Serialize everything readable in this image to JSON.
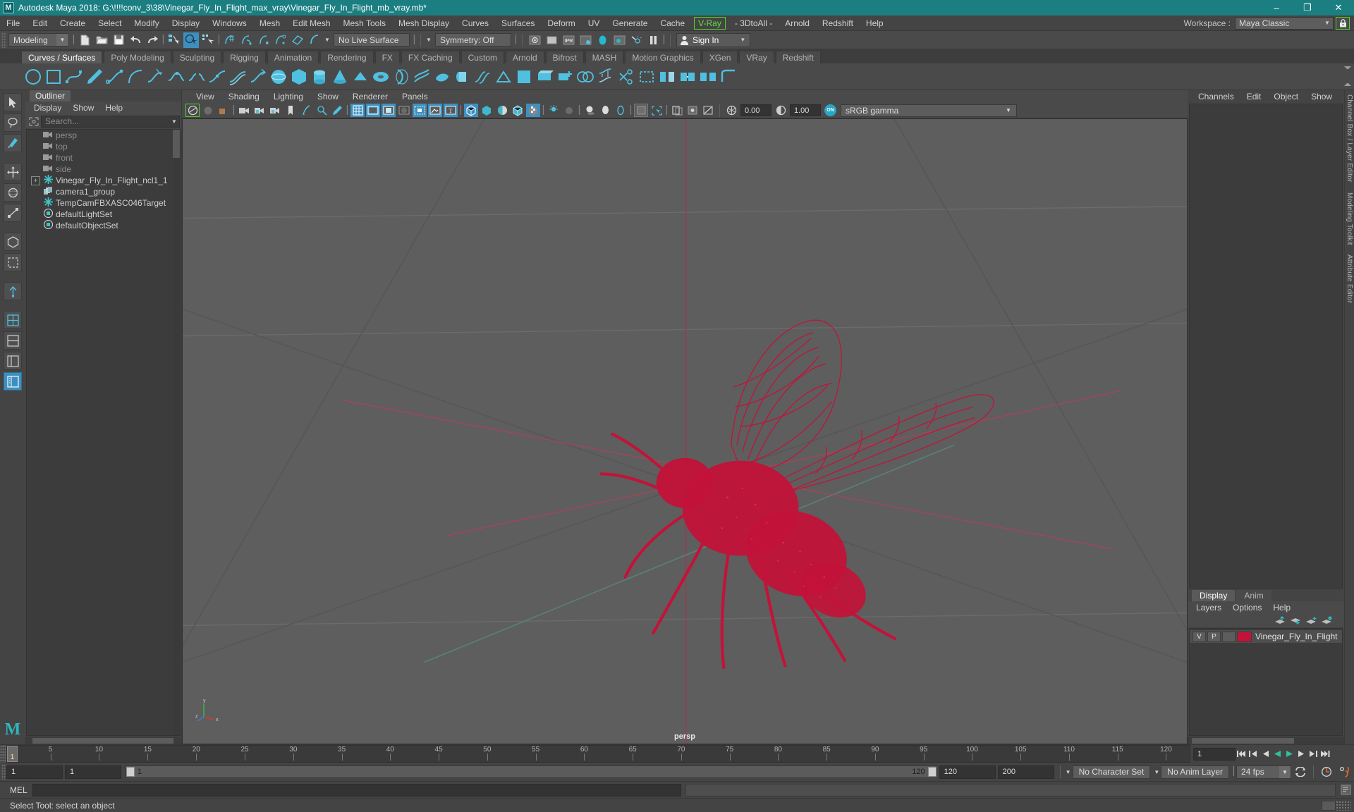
{
  "window": {
    "title": "Autodesk Maya 2018: G:\\!!!!conv_3\\38\\Vinegar_Fly_In_Flight_max_vray\\Vinegar_Fly_In_Flight_mb_vray.mb*",
    "logo_letter": "M",
    "minimize": "–",
    "maximize": "❐",
    "close": "✕",
    "titlebar_color": "#1b7f82"
  },
  "menubar": {
    "items": [
      {
        "label": "File"
      },
      {
        "label": "Edit"
      },
      {
        "label": "Create"
      },
      {
        "label": "Select"
      },
      {
        "label": "Modify"
      },
      {
        "label": "Display"
      },
      {
        "label": "Windows"
      },
      {
        "label": "Mesh"
      },
      {
        "label": "Edit Mesh"
      },
      {
        "label": "Mesh Tools"
      },
      {
        "label": "Mesh Display"
      },
      {
        "label": "Curves"
      },
      {
        "label": "Surfaces"
      },
      {
        "label": "Deform"
      },
      {
        "label": "UV"
      },
      {
        "label": "Generate"
      },
      {
        "label": "Cache"
      }
    ],
    "vray": "V-Ray",
    "after_vray": [
      {
        "label": "- 3DtoAll -"
      },
      {
        "label": "Arnold"
      },
      {
        "label": "Redshift"
      },
      {
        "label": "Help"
      }
    ],
    "workspace_label": "Workspace :",
    "workspace_value": "Maya Classic",
    "lock_icon": "lock-icon",
    "highlight_color": "#4cd427"
  },
  "statusline": {
    "menuset": "Modeling",
    "live_surface": "No Live Surface",
    "symmetry": "Symmetry: Off",
    "signin": "Sign In",
    "icons_file": [
      "new-scene-icon",
      "open-scene-icon",
      "save-scene-icon",
      "undo-icon",
      "redo-icon"
    ],
    "icons_select": [
      "select-hierarchy-icon",
      "select-object-icon",
      "select-component-icon"
    ],
    "icons_snap": [
      "snap-grid-icon",
      "snap-curve-icon",
      "snap-point-icon",
      "snap-projected-icon",
      "snap-view-plane-icon",
      "make-live-icon"
    ],
    "icons_render": [
      "render-view-icon",
      "render-current-frame-icon",
      "ipr-render-icon",
      "render-settings-icon",
      "hypershade-icon",
      "render-setup-icon",
      "light-editor-icon",
      "pause-icon"
    ]
  },
  "shelf": {
    "tabs": [
      {
        "label": "Curves / Surfaces",
        "active": true
      },
      {
        "label": "Poly Modeling",
        "active": false
      },
      {
        "label": "Sculpting",
        "active": false
      },
      {
        "label": "Rigging",
        "active": false
      },
      {
        "label": "Animation",
        "active": false
      },
      {
        "label": "Rendering",
        "active": false
      },
      {
        "label": "FX",
        "active": false
      },
      {
        "label": "FX Caching",
        "active": false
      },
      {
        "label": "Custom",
        "active": false
      },
      {
        "label": "Arnold",
        "active": false
      },
      {
        "label": "Bifrost",
        "active": false
      },
      {
        "label": "MASH",
        "active": false
      },
      {
        "label": "Motion Graphics",
        "active": false
      },
      {
        "label": "XGen",
        "active": false
      },
      {
        "label": "VRay",
        "active": false
      },
      {
        "label": "Redshift",
        "active": false
      }
    ],
    "icons": [
      "nurbs-circle-icon",
      "nurbs-square-icon",
      "ep-curve-icon",
      "pencil-curve-icon",
      "bezier-curve-icon",
      "arc-curve-icon",
      "curve-tangent-icon",
      "attach-curve-icon",
      "detach-curve-icon",
      "insert-knot-icon",
      "offset-curve-icon",
      "rebuild-curve-icon",
      "nurbs-sphere-icon",
      "nurbs-cube-icon",
      "nurbs-cylinder-icon",
      "nurbs-cone-icon",
      "nurbs-plane-icon",
      "nurbs-torus-icon",
      "revolve-icon",
      "loft-icon",
      "planar-icon",
      "extrude-icon",
      "birail-icon",
      "boundary-icon",
      "square-surface-icon",
      "bevel-icon",
      "bevel-plus-icon",
      "intersect-surfaces-icon",
      "project-curve-icon",
      "trim-tool-icon",
      "untrim-icon",
      "align-surfaces-icon",
      "attach-surfaces-icon",
      "detach-surfaces-icon",
      "surface-fillet-icon"
    ]
  },
  "toolbox": {
    "tools": [
      {
        "name": "select-tool",
        "active": false
      },
      {
        "name": "lasso-select-tool",
        "active": false
      },
      {
        "name": "paint-select-tool",
        "active": false
      },
      {
        "name": "move-tool",
        "active": false
      },
      {
        "name": "rotate-tool",
        "active": false
      },
      {
        "name": "scale-tool",
        "active": false
      },
      {
        "name": "universal-manipulator",
        "active": false
      },
      {
        "name": "soft-modification-tool",
        "active": false
      },
      {
        "name": "show-manipulator-tool",
        "active": false
      },
      {
        "name": "last-tool-used",
        "active": false
      },
      {
        "name": "single-perspective-layout",
        "active": true
      }
    ],
    "maya_logo": "M"
  },
  "outliner": {
    "tab": "Outliner",
    "menus": [
      "Display",
      "Show",
      "Help"
    ],
    "search_placeholder": "Search...",
    "items": [
      {
        "label": "persp",
        "icon": "camera-icon",
        "dim": true,
        "expand": false
      },
      {
        "label": "top",
        "icon": "camera-icon",
        "dim": true,
        "expand": false
      },
      {
        "label": "front",
        "icon": "camera-icon",
        "dim": true,
        "expand": false
      },
      {
        "label": "side",
        "icon": "camera-icon",
        "dim": true,
        "expand": false
      },
      {
        "label": "Vinegar_Fly_In_Flight_ncl1_1",
        "icon": "transform-icon",
        "dim": false,
        "expand": true
      },
      {
        "label": "camera1_group",
        "icon": "group-icon",
        "dim": false,
        "expand": false
      },
      {
        "label": "TempCamFBXASC046Target",
        "icon": "transform-icon",
        "dim": false,
        "expand": false
      },
      {
        "label": "defaultLightSet",
        "icon": "set-icon",
        "dim": false,
        "expand": false
      },
      {
        "label": "defaultObjectSet",
        "icon": "set-icon",
        "dim": false,
        "expand": false
      }
    ]
  },
  "viewport": {
    "menus": [
      "View",
      "Shading",
      "Lighting",
      "Show",
      "Renderer",
      "Panels"
    ],
    "camera_label": "persp",
    "exposure_value": "0.00",
    "gamma_value": "1.00",
    "color_space": "sRGB gamma",
    "on_badge": "ON",
    "toolbar_icons": [
      "select-camera-icon",
      "lock-camera-icon",
      "camera-attributes-icon",
      "bookmark-icon",
      "image-plane-icon",
      "two-d-pan-zoom-icon",
      "grease-pencil-icon",
      "grid-toggle-icon",
      "film-gate-icon",
      "resolution-gate-icon",
      "gate-mask-icon",
      "field-chart-icon",
      "safe-action-icon",
      "safe-title-icon",
      "wireframe-icon",
      "smooth-shade-icon",
      "flat-shade-icon",
      "shaded-wireframe-icon",
      "textured-icon",
      "use-default-lighting-icon",
      "use-all-lights-icon",
      "shadows-icon",
      "ambient-occlusion-icon",
      "motion-blur-icon",
      "multisample-icon",
      "isolate-select-icon",
      "xray-icon",
      "xray-joints-icon",
      "exposure-icon",
      "gamma-icon"
    ],
    "model": {
      "name": "Vinegar Fly In Flight",
      "wireframe_color": "#c41239",
      "background_color": "#5e5e5e"
    },
    "axis": {
      "x": "x",
      "y": "y",
      "z": "z"
    }
  },
  "channelbox": {
    "tabs": [
      "Channels",
      "Edit",
      "Object",
      "Show"
    ],
    "rail_labels": [
      "Channel Box / Layer Editor",
      "Modeling Toolkit",
      "Attribute Editor"
    ]
  },
  "layers": {
    "tabs": [
      {
        "label": "Display",
        "active": true
      },
      {
        "label": "Anim",
        "active": false
      }
    ],
    "menus": [
      "Layers",
      "Options",
      "Help"
    ],
    "buttons": [
      "move-layer-up-icon",
      "move-layer-down-icon",
      "new-layer-icon",
      "new-layer-from-selected-icon"
    ],
    "rows": [
      {
        "visibility": "V",
        "playback": "P",
        "shading": "",
        "color": "#c41239",
        "name": "Vinegar_Fly_In_Flight"
      }
    ]
  },
  "timeslider": {
    "current_frame": "1",
    "ticks": [
      {
        "label": "5",
        "pct": 3.67
      },
      {
        "label": "10",
        "pct": 7.78
      },
      {
        "label": "15",
        "pct": 11.89
      },
      {
        "label": "20",
        "pct": 16.0
      },
      {
        "label": "25",
        "pct": 20.1
      },
      {
        "label": "30",
        "pct": 24.2
      },
      {
        "label": "35",
        "pct": 28.3
      },
      {
        "label": "40",
        "pct": 32.4
      },
      {
        "label": "45",
        "pct": 36.5
      },
      {
        "label": "50",
        "pct": 40.6
      },
      {
        "label": "55",
        "pct": 44.7
      },
      {
        "label": "60",
        "pct": 48.8
      },
      {
        "label": "65",
        "pct": 52.9
      },
      {
        "label": "70",
        "pct": 57.0
      },
      {
        "label": "75",
        "pct": 61.1
      },
      {
        "label": "80",
        "pct": 65.2
      },
      {
        "label": "85",
        "pct": 69.3
      },
      {
        "label": "90",
        "pct": 73.4
      },
      {
        "label": "95",
        "pct": 77.5
      },
      {
        "label": "100",
        "pct": 81.6
      },
      {
        "label": "105",
        "pct": 85.7
      },
      {
        "label": "110",
        "pct": 89.8
      },
      {
        "label": "115",
        "pct": 93.9
      },
      {
        "label": "120",
        "pct": 98.0
      }
    ],
    "frame_field": "1",
    "playback_buttons": [
      "go-to-start-icon",
      "step-back-key-icon",
      "step-back-frame-icon",
      "play-backwards-icon",
      "play-forwards-icon",
      "step-forward-frame-icon",
      "step-forward-key-icon",
      "go-to-end-icon"
    ]
  },
  "rangeslider": {
    "start_field": "1",
    "playback_start_field": "1",
    "range_left_label": "1",
    "range_right_label": "120",
    "playback_end_field": "120",
    "end_field": "200",
    "character_set": "No Character Set",
    "anim_layer": "No Anim Layer",
    "fps": "24 fps",
    "icons": [
      "auto-keyframe-icon",
      "animation-preferences-icon",
      "playback-loop-icon"
    ]
  },
  "commandline": {
    "label": "MEL",
    "input_value": "",
    "output_value": "",
    "script-editor-icon": "script-editor-icon"
  },
  "statusbar": {
    "message": "Select Tool: select an object"
  }
}
